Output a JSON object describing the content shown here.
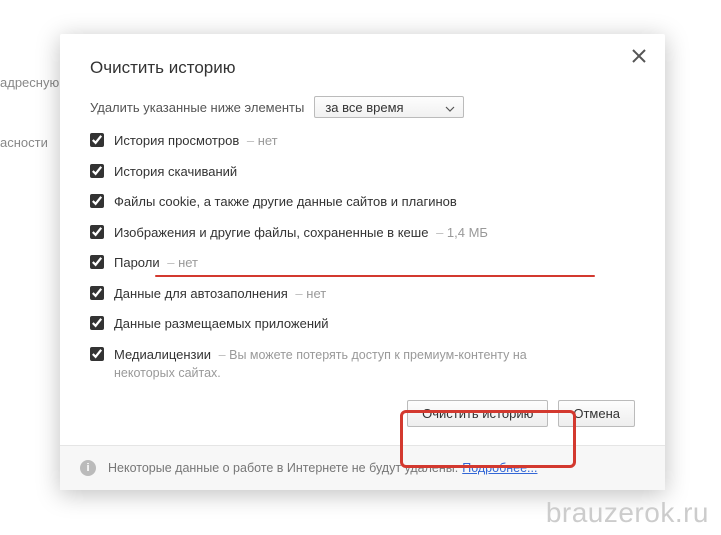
{
  "background": {
    "line1": "адресную (",
    "line2": "асности"
  },
  "dialog": {
    "title": "Очистить историю",
    "delete_label": "Удалить указанные ниже элементы",
    "dropdown_value": "за все время",
    "items": [
      {
        "label": "История просмотров",
        "extra": "нет",
        "checked": true
      },
      {
        "label": "История скачиваний",
        "extra": "",
        "checked": true
      },
      {
        "label": "Файлы cookie, а также другие данные сайтов и плагинов",
        "extra": "",
        "checked": true
      },
      {
        "label": "Изображения и другие файлы, сохраненные в кеше",
        "extra": "1,4 МБ",
        "checked": true
      },
      {
        "label": "Пароли",
        "extra": "нет",
        "checked": true
      },
      {
        "label": "Данные для автозаполнения",
        "extra": "нет",
        "checked": true
      },
      {
        "label": "Данные размещаемых приложений",
        "extra": "",
        "checked": true
      },
      {
        "label": "Медиалицензии",
        "extra": "Вы можете потерять доступ к премиум-контенту на некоторых сайтах.",
        "checked": true,
        "multiline": true
      }
    ],
    "buttons": {
      "clear": "Очистить историю",
      "cancel": "Отмена"
    },
    "footer_text": "Некоторые данные о работе в Интернете не будут удалены.",
    "footer_link": "Подробнее..."
  },
  "watermark": "brauzerok.ru"
}
